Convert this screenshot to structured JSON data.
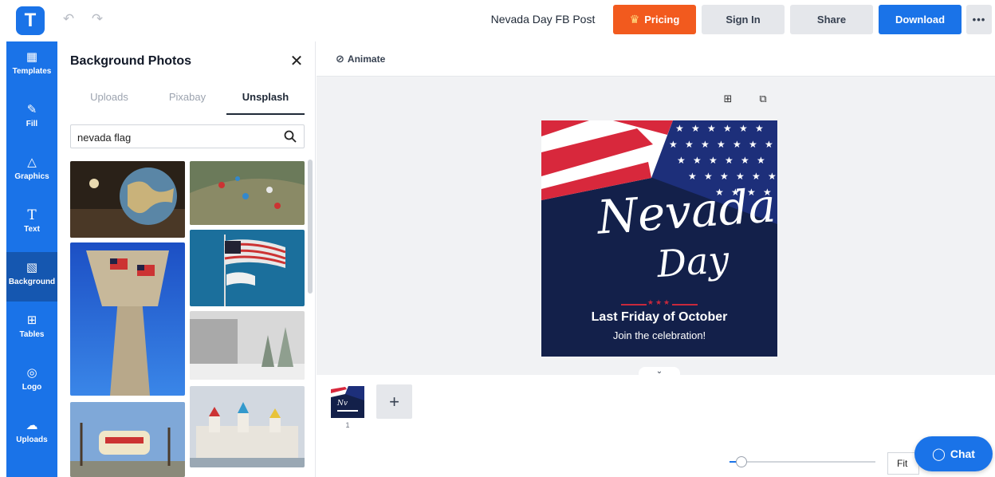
{
  "header": {
    "logo": "T",
    "doc_title": "Nevada Day FB Post",
    "pricing_label": "Pricing",
    "signin_label": "Sign In",
    "share_label": "Share",
    "download_label": "Download",
    "more_label": "•••"
  },
  "sidebar": {
    "items": [
      {
        "label": "Templates",
        "icon": "templates-icon"
      },
      {
        "label": "Fill",
        "icon": "pen-icon"
      },
      {
        "label": "Graphics",
        "icon": "shapes-icon"
      },
      {
        "label": "Text",
        "icon": "text-icon"
      },
      {
        "label": "Background",
        "icon": "background-icon"
      },
      {
        "label": "Tables",
        "icon": "table-icon"
      },
      {
        "label": "Logo",
        "icon": "logo-icon"
      },
      {
        "label": "Uploads",
        "icon": "cloud-upload-icon"
      }
    ]
  },
  "panel": {
    "title": "Background Photos",
    "tabs": [
      "Uploads",
      "Pixabay",
      "Unsplash"
    ],
    "search_value": "nevada flag"
  },
  "toolbar": {
    "animate_label": "Animate"
  },
  "design": {
    "title_line1": "Nevada",
    "title_line2": "Day",
    "headline": "Last Friday of October",
    "subline": "Join the celebration!"
  },
  "pages": {
    "current": "1",
    "add_label": "+"
  },
  "footer": {
    "zoom_label": "Fit",
    "chat_label": "Chat"
  },
  "colors": {
    "brand_blue": "#1a73e8",
    "pricing_orange": "#f25a1e",
    "design_navy": "#13204a",
    "flag_red": "#c8283c"
  }
}
